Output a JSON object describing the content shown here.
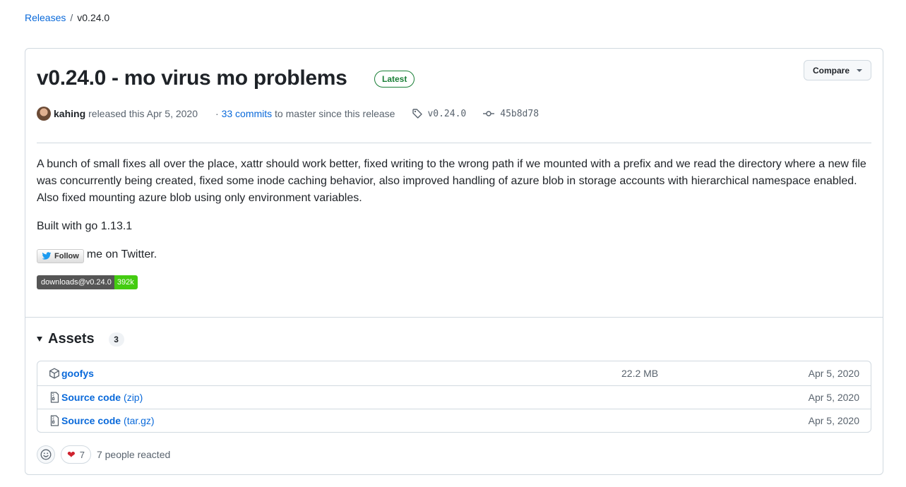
{
  "breadcrumb": {
    "parent": "Releases",
    "separator": "/",
    "current": "v0.24.0"
  },
  "release": {
    "title": "v0.24.0 - mo virus mo problems",
    "badge": "Latest",
    "compare_label": "Compare",
    "author": "kahing",
    "released_text": "released this Apr 5, 2020",
    "commits_prefix": "·",
    "commits_link": "33 commits",
    "commits_suffix": "to master since this release",
    "tag": "v0.24.0",
    "commit_sha": "45b8d78"
  },
  "body": {
    "paragraph1": "A bunch of small fixes all over the place, xattr should work better, fixed writing to the wrong path if we mounted with a prefix and we read the directory where a new file was concurrently being created, fixed some inode caching behavior, also improved handling of azure blob in storage accounts with hierarchical namespace enabled. Also fixed mounting azure blob using only environment variables.",
    "paragraph2": "Built with go 1.13.1",
    "follow_button": "Follow",
    "follow_suffix": "me on Twitter.",
    "downloads_badge_label": "downloads@v0.24.0",
    "downloads_badge_value": "392k"
  },
  "assets": {
    "title": "Assets",
    "count": "3",
    "items": [
      {
        "name": "goofys",
        "ext": "",
        "size": "22.2 MB",
        "date": "Apr 5, 2020",
        "icon": "package-icon"
      },
      {
        "name": "Source code",
        "ext": "(zip)",
        "size": "",
        "date": "Apr 5, 2020",
        "icon": "file-zip-icon"
      },
      {
        "name": "Source code",
        "ext": "(tar.gz)",
        "size": "",
        "date": "Apr 5, 2020",
        "icon": "file-zip-icon"
      }
    ]
  },
  "reactions": {
    "heart_count": "7",
    "summary": "7 people reacted"
  },
  "colors": {
    "link": "#0969da",
    "latest_badge": "#1a7f37",
    "border": "#d1d9e0",
    "badge_value_bg": "#44cc11"
  }
}
